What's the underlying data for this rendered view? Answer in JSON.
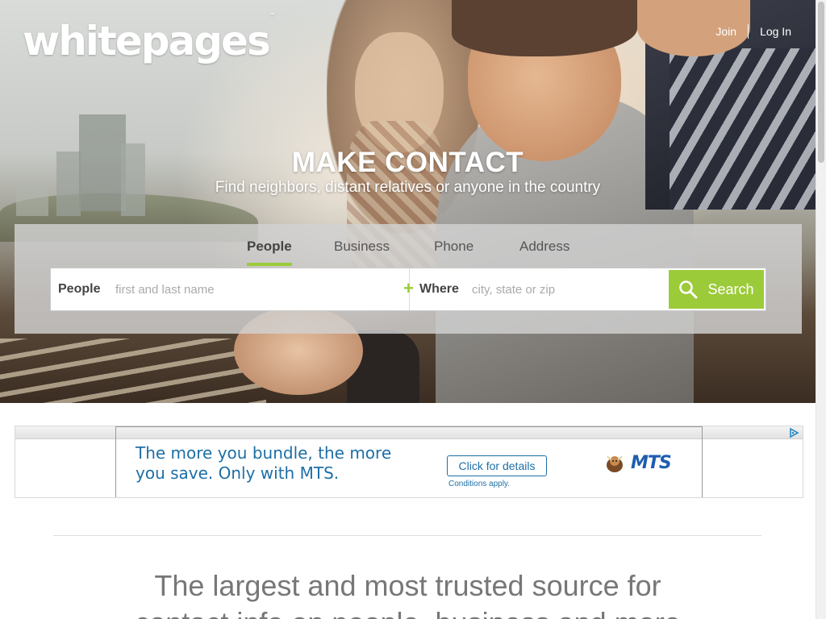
{
  "brand": {
    "logo_text": "whitepages",
    "trademark": "™"
  },
  "topnav": {
    "join": "Join",
    "login": "Log In"
  },
  "hero": {
    "headline": "MAKE CONTACT",
    "subheadline": "Find neighbors, distant relatives or anyone in the country"
  },
  "search": {
    "tabs": [
      {
        "label": "People",
        "active": true
      },
      {
        "label": "Business",
        "active": false
      },
      {
        "label": "Phone",
        "active": false
      },
      {
        "label": "Address",
        "active": false
      }
    ],
    "who_label": "People",
    "who_placeholder": "first and last name",
    "where_label": "Where",
    "where_placeholder": "city, state or zip",
    "button_label": "Search"
  },
  "ad": {
    "text": "The more you bundle, the more you save. Only with MTS.",
    "cta": "Click for details",
    "conditions": "Conditions apply.",
    "brand": "MTS"
  },
  "tagline": {
    "line1": "The largest and most trusted source for",
    "line2": "contact info on people, business and more"
  },
  "colors": {
    "accent_green": "#9ccb3a",
    "ad_blue": "#1d6fa6",
    "mts_blue": "#1e5db0"
  }
}
